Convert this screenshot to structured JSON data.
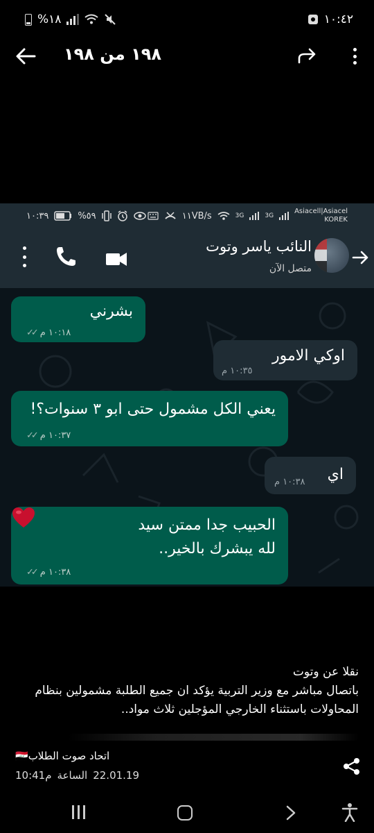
{
  "status_bar": {
    "time": "١٠:٤٢",
    "battery": "%١٨"
  },
  "viewer": {
    "counter": "١٩٨ من ١٩٨"
  },
  "whatsapp": {
    "status": {
      "time": "١٠:٣٩",
      "battery": "%٥٩",
      "speed": "١١VB/s",
      "net1": "3G",
      "net2": "3G",
      "carrier1": "Asiacell|Asiacel",
      "carrier2": "KOREK"
    },
    "contact_name": "النائب ياسر وتوت",
    "contact_status": "متصل الآن",
    "messages": [
      {
        "dir": "sent",
        "text": "بشرني",
        "time": "١٠:١٨ م"
      },
      {
        "dir": "received",
        "text": "اوكي الامور",
        "time": "١٠:٣٥ م"
      },
      {
        "dir": "sent",
        "text": "يعني الكل مشمول حتى ابو ٣ سنوات؟!",
        "time": "١٠:٣٧ م"
      },
      {
        "dir": "received",
        "text": "اي",
        "time": "١٠:٣٨ م"
      },
      {
        "dir": "sent",
        "line1": "الحبيب جدا ممتن سيد",
        "line2": "لله يبشرك بالخير..",
        "time": "١٠:٣٨ م"
      }
    ]
  },
  "caption": {
    "line1": "نقلا عن وتوت",
    "line2": "باتصال مباشر مع وزير التربية يؤكد ان جميع الطلبة مشمولين بنظام",
    "line3": "المحاولات باستثناء الخارجي المؤجلين ثلاث مواد.."
  },
  "post": {
    "author": "اتحاد صوت الطلاب🇮🇶",
    "date": "22.01.19",
    "time_label": "الساعة",
    "time": "10:41م"
  },
  "icons": {
    "back": "arrow-left-icon",
    "share_forward": "share-forward-icon",
    "more": "more-vertical-icon",
    "share": "share-icon",
    "heart": "heart-emoji-icon"
  },
  "colors": {
    "sent_bubble": "#005c4b",
    "received_bubble": "#1f2c34",
    "wa_header": "#1f2c34",
    "wa_bg": "#0b141a"
  }
}
